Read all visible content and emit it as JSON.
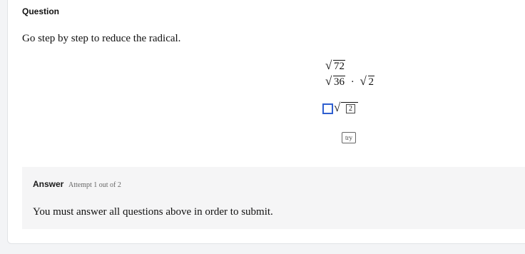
{
  "question": {
    "heading": "Question",
    "prompt": "Go step by step to reduce the radical.",
    "radical_top": "72",
    "radical_left": "36",
    "radical_right": "2",
    "dot": "·",
    "answer_inner_value": "2",
    "try_label": "try"
  },
  "answer": {
    "heading": "Answer",
    "attempt": "Attempt 1 out of 2",
    "message": "You must answer all questions above in order to submit."
  }
}
